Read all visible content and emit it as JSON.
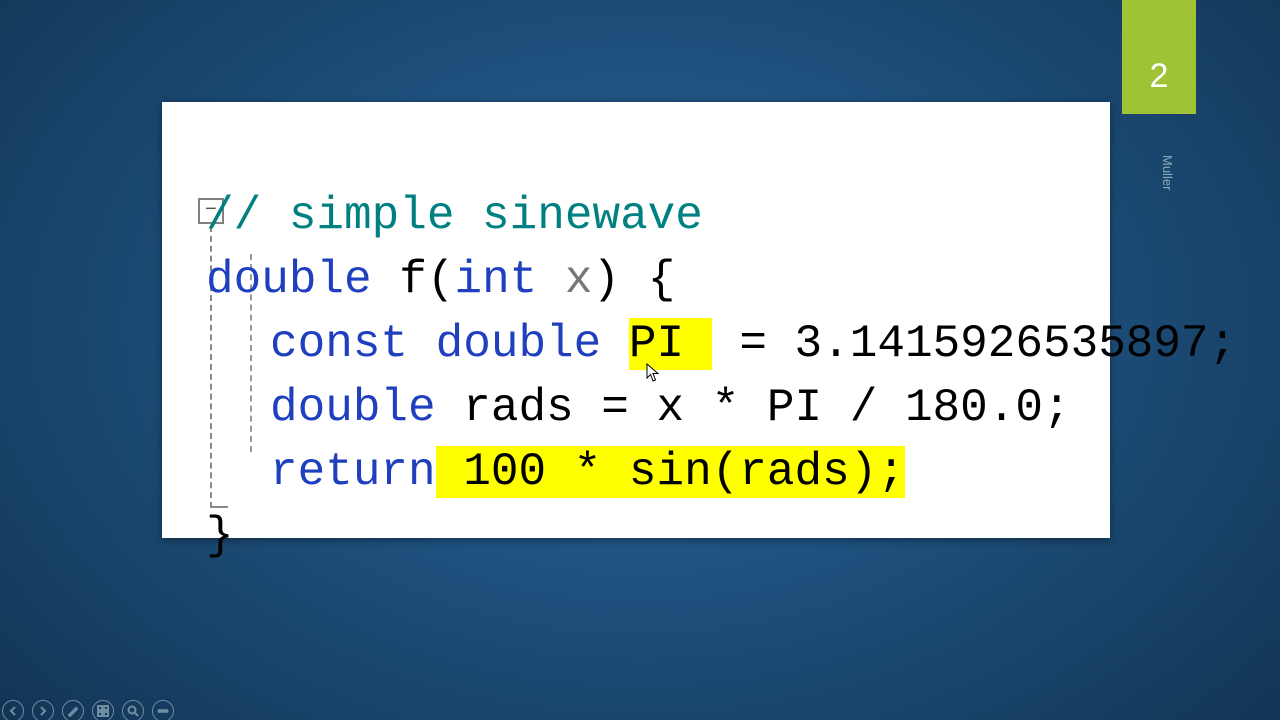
{
  "slide": {
    "number": "2",
    "author": "Muller"
  },
  "code": {
    "comment": "// simple sinewave",
    "kw_double": "double",
    "fn_name": "f",
    "kw_int": "int",
    "param_x": "x",
    "brace_open": "{",
    "kw_const": "const",
    "id_PI": "PI",
    "eq": " = ",
    "pi_val": "3.1415926535897",
    "semi": ";",
    "id_rads": "rads",
    "expr_xr": "x * PI / 180.0",
    "expr_eq": " = ",
    "kw_return": "return",
    "ret_expr_hl": " 100 * sin(rads);",
    "brace_close": "}"
  },
  "fold": {
    "symbol": "−"
  },
  "controls": {
    "prev": "prev-slide",
    "next": "next-slide",
    "pen": "pen-tool",
    "allslides": "see-all-slides",
    "zoom": "zoom",
    "more": "more-options"
  }
}
